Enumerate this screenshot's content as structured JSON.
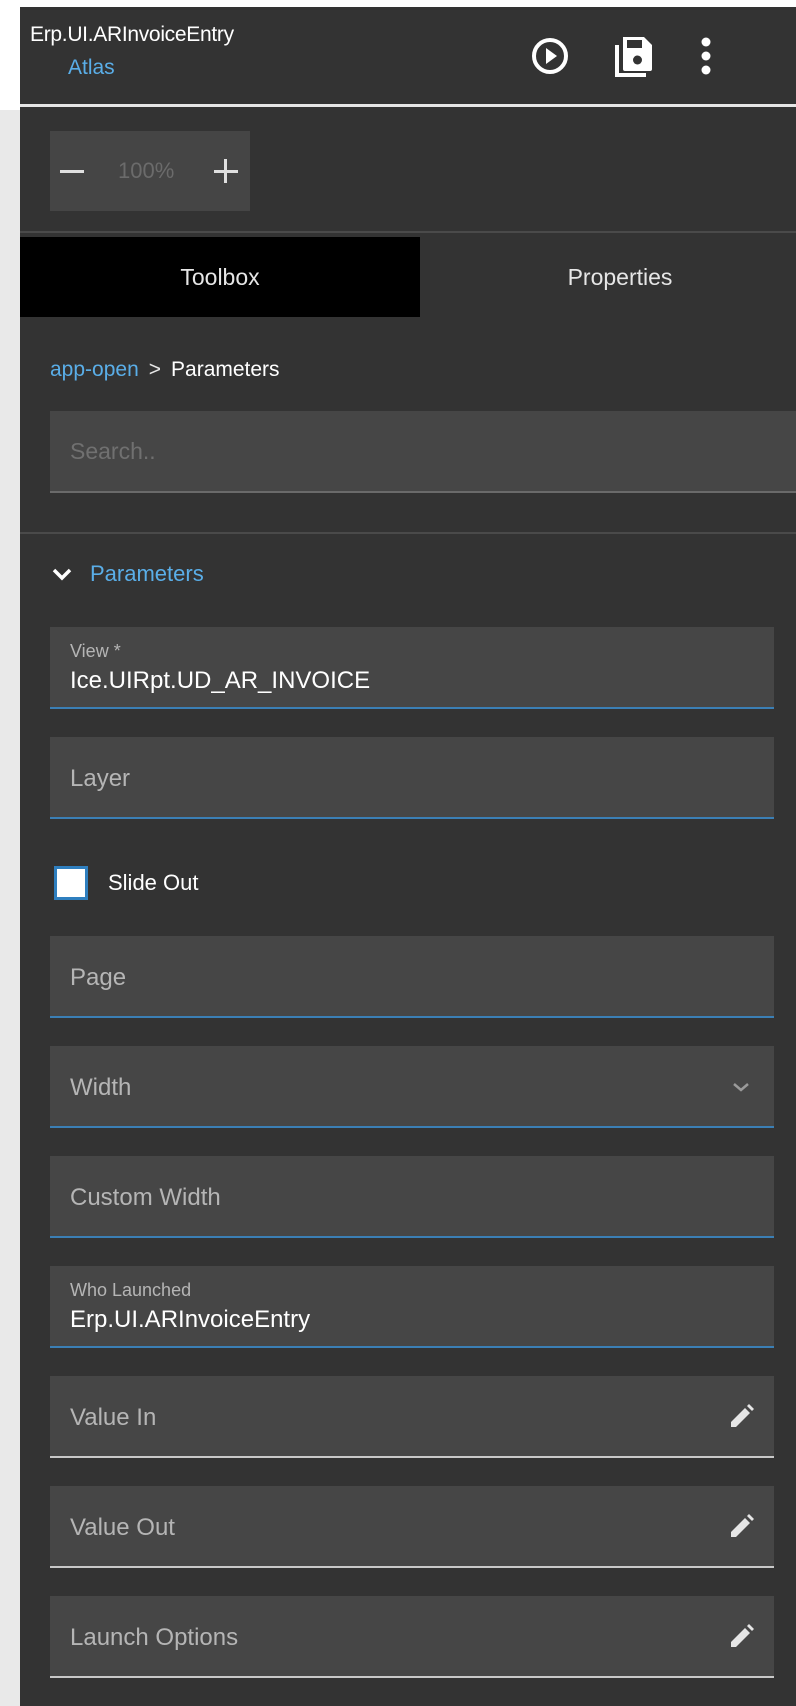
{
  "header": {
    "app_title": "Erp.UI.ARInvoiceEntry",
    "app_subtitle": "Atlas",
    "actions": [
      {
        "name": "run",
        "icon": "play-circle-icon"
      },
      {
        "name": "save",
        "icon": "save-icon"
      },
      {
        "name": "more",
        "icon": "more-vert-icon"
      }
    ]
  },
  "zoom": {
    "value": "100%",
    "minus_icon": "minus-icon",
    "plus_icon": "plus-icon"
  },
  "tabs": [
    {
      "label": "Toolbox",
      "active": true
    },
    {
      "label": "Properties",
      "active": false
    }
  ],
  "breadcrumb": {
    "link": "app-open",
    "separator": ">",
    "current": "Parameters"
  },
  "search": {
    "placeholder": "Search..",
    "value": ""
  },
  "section": {
    "title": "Parameters",
    "expanded": true,
    "icon": "chevron-down-icon"
  },
  "fields": {
    "view": {
      "label": "View *",
      "value": "Ice.UIRpt.UD_AR_INVOICE"
    },
    "layer": {
      "label": "Layer"
    },
    "slide_out": {
      "label": "Slide Out",
      "checked": false
    },
    "page": {
      "label": "Page"
    },
    "width": {
      "label": "Width",
      "icon": "chevron-down-icon"
    },
    "custom_width": {
      "label": "Custom Width"
    },
    "who_launched": {
      "label": "Who Launched",
      "value": "Erp.UI.ARInvoiceEntry"
    },
    "value_in": {
      "label": "Value In",
      "icon": "pencil-icon"
    },
    "value_out": {
      "label": "Value Out",
      "icon": "pencil-icon"
    },
    "launch_options": {
      "label": "Launch Options",
      "icon": "pencil-icon"
    }
  },
  "colors": {
    "panel_bg": "#333333",
    "field_bg": "#464646",
    "accent": "#5aaee8",
    "active_tab": "#000000"
  }
}
